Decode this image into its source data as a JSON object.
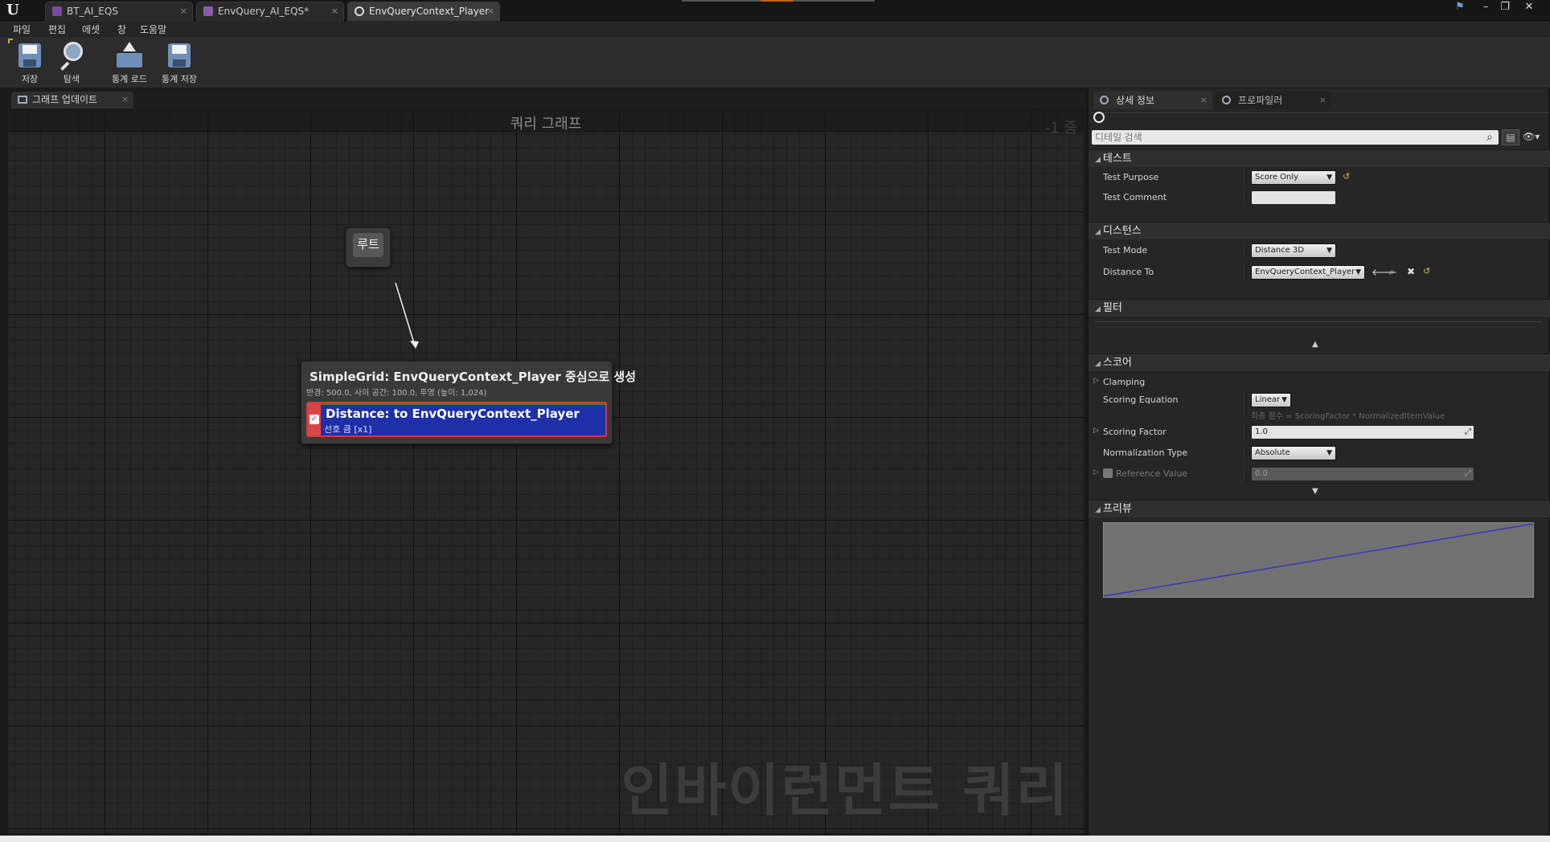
{
  "titlebar": {
    "tabs": [
      {
        "label": "BT_AI_EQS",
        "active": false
      },
      {
        "label": "EnvQuery_AI_EQS*",
        "active": false
      },
      {
        "label": "EnvQueryContext_Player",
        "active": true
      }
    ],
    "close_glyph": "×"
  },
  "menu": [
    "파일",
    "편집",
    "에셋",
    "창",
    "도움말"
  ],
  "toolbar": {
    "save_label": "저장",
    "browse_label": "탐색",
    "load_stats_label": "통계 로드",
    "save_stats_label": "통계 저장"
  },
  "graph": {
    "tab_label": "그래프 업데이트",
    "title": "쿼리 그래프",
    "zoom": "-1 줌",
    "watermark": "인바이런먼트 쿼리",
    "root_label": "루트",
    "generator": {
      "title": "SimpleGrid: EnvQueryContext_Player 중심으로 생성",
      "subtitle": "반경: 500.0, 사이 공간: 100.0, 투영 (높이: 1,024)"
    },
    "test": {
      "title": "Distance: to EnvQueryContext_Player",
      "subtitle": "선호 큼 [x1]",
      "enabled": true
    }
  },
  "details": {
    "tabs": [
      "상세 정보",
      "프로파일러"
    ],
    "search_placeholder": "디테일 검색",
    "sections": {
      "test": "테스트",
      "distance": "디스턴스",
      "filter": "필터",
      "score": "스코어",
      "preview": "프리뷰"
    },
    "test_purpose": {
      "label": "Test Purpose",
      "value": "Score Only"
    },
    "test_comment": {
      "label": "Test Comment",
      "value": ""
    },
    "test_mode": {
      "label": "Test Mode",
      "value": "Distance 3D"
    },
    "distance_to": {
      "label": "Distance To",
      "value": "EnvQueryContext_Player"
    },
    "clamping": {
      "label": "Clamping"
    },
    "scoring_equation": {
      "label": "Scoring Equation",
      "value": "Linear",
      "hint": "최종 점수 = ScoringFactor * NormalizedItemValue"
    },
    "scoring_factor": {
      "label": "Scoring Factor",
      "value": "1.0"
    },
    "normalization_type": {
      "label": "Normalization Type",
      "value": "Absolute"
    },
    "reference_value": {
      "label": "Reference Value",
      "value": "0.0",
      "enabled": false
    },
    "preview_line_color": "#3a34c8"
  }
}
